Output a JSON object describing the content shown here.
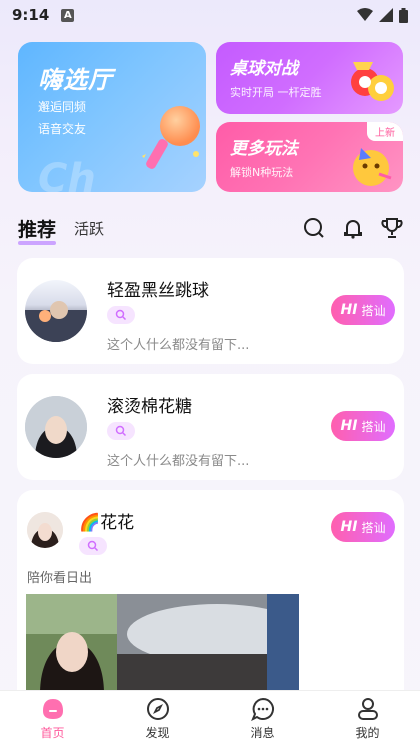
{
  "status_bar": {
    "time": "9:14",
    "indicator": "A"
  },
  "banners": {
    "main": {
      "title": "嗨选厅",
      "line1": "邂逅同频",
      "line2": "语音交友",
      "ghost": "Ch"
    },
    "billiards": {
      "title": "桌球对战",
      "sub": "实时开局 一杆定胜"
    },
    "more": {
      "title": "更多玩法",
      "sub": "解锁N种玩法",
      "badge": "上新"
    }
  },
  "tabs": {
    "recommend": "推荐",
    "active": "活跃"
  },
  "cards": [
    {
      "name": "轻盈黑丝跳球",
      "bio": "这个人什么都没有留下...",
      "hi": "HI",
      "action": "搭讪"
    },
    {
      "name": "滚烫棉花糖",
      "bio": "这个人什么都没有留下...",
      "hi": "HI",
      "action": "搭讪"
    },
    {
      "name": "🌈花花",
      "bio": "陪你看日出",
      "hi": "HI",
      "action": "搭讪"
    }
  ],
  "bottom_nav": [
    {
      "label": "首页",
      "icon": "home-icon",
      "active": true
    },
    {
      "label": "发现",
      "icon": "compass-icon"
    },
    {
      "label": "消息",
      "icon": "chat-icon"
    },
    {
      "label": "我的",
      "icon": "profile-icon"
    }
  ],
  "colors": {
    "accent": "#ff5a9c",
    "purple": "#c45bff",
    "blue": "#5fb6ff"
  }
}
